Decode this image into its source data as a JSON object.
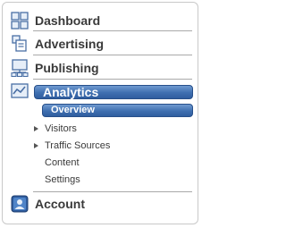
{
  "menu": {
    "items": [
      {
        "label": "Dashboard",
        "icon": "dashboard-icon"
      },
      {
        "label": "Advertising",
        "icon": "advertising-icon"
      },
      {
        "label": "Publishing",
        "icon": "publishing-icon"
      },
      {
        "label": "Analytics",
        "icon": "analytics-icon",
        "active": true
      },
      {
        "label": "Account",
        "icon": "account-icon"
      }
    ],
    "analytics_subitems": [
      {
        "label": "Overview",
        "active": true
      },
      {
        "label": "Visitors",
        "expandable": true
      },
      {
        "label": "Traffic Sources",
        "expandable": true
      },
      {
        "label": "Content"
      },
      {
        "label": "Settings"
      }
    ]
  },
  "colors": {
    "active_blue": "#3f6fb0",
    "text": "#3a3a3a",
    "divider": "#a9a9a9"
  }
}
